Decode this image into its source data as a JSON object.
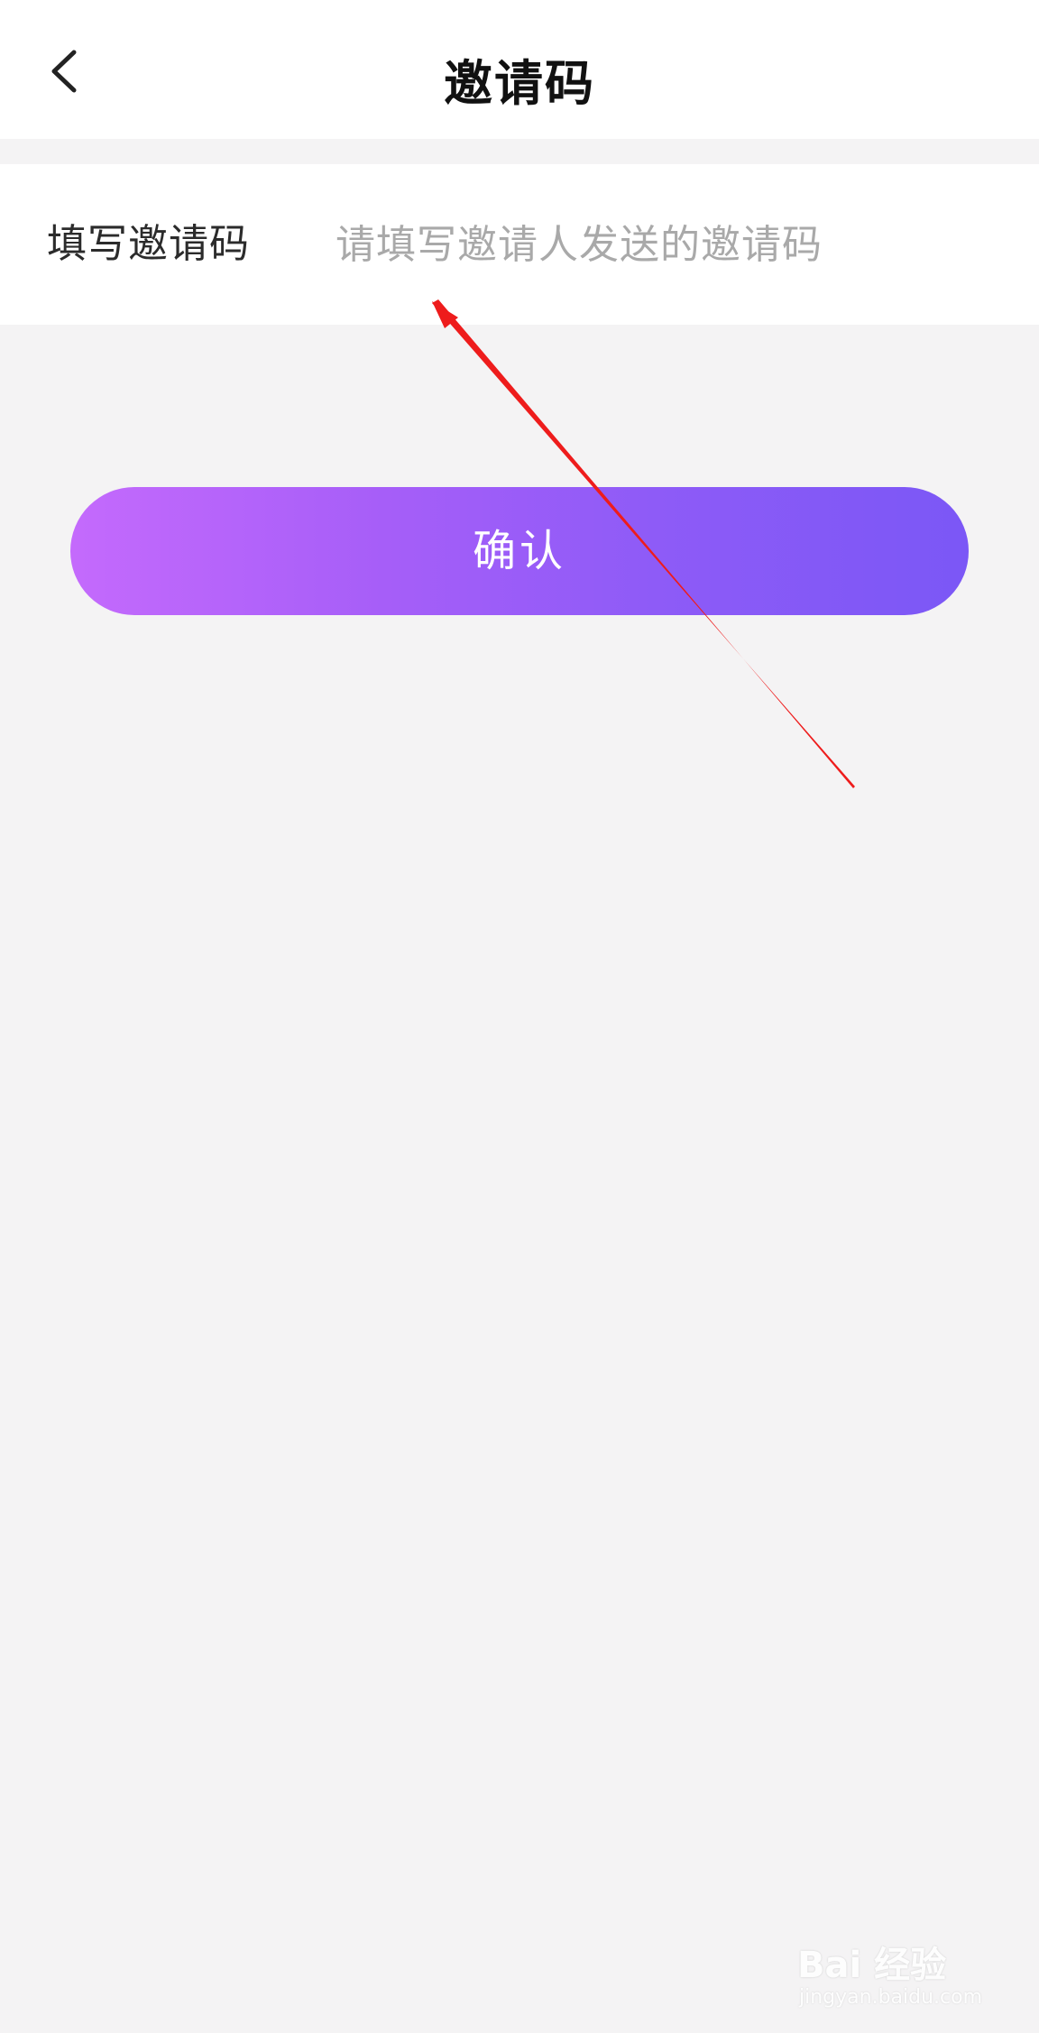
{
  "header": {
    "title": "邀请码",
    "back_icon": "chevron-left-icon"
  },
  "invite_form": {
    "label": "填写邀请码",
    "value": "",
    "placeholder": "请填写邀请人发送的邀请码"
  },
  "confirm_button": {
    "label": "确认",
    "gradient_start": "#c46afc",
    "gradient_end": "#7b57f6"
  },
  "annotation": {
    "type": "red-arrow",
    "color": "#ee1c1c"
  },
  "watermark": {
    "brand": "Bai 经验",
    "url": "jingyan.baidu.com"
  }
}
